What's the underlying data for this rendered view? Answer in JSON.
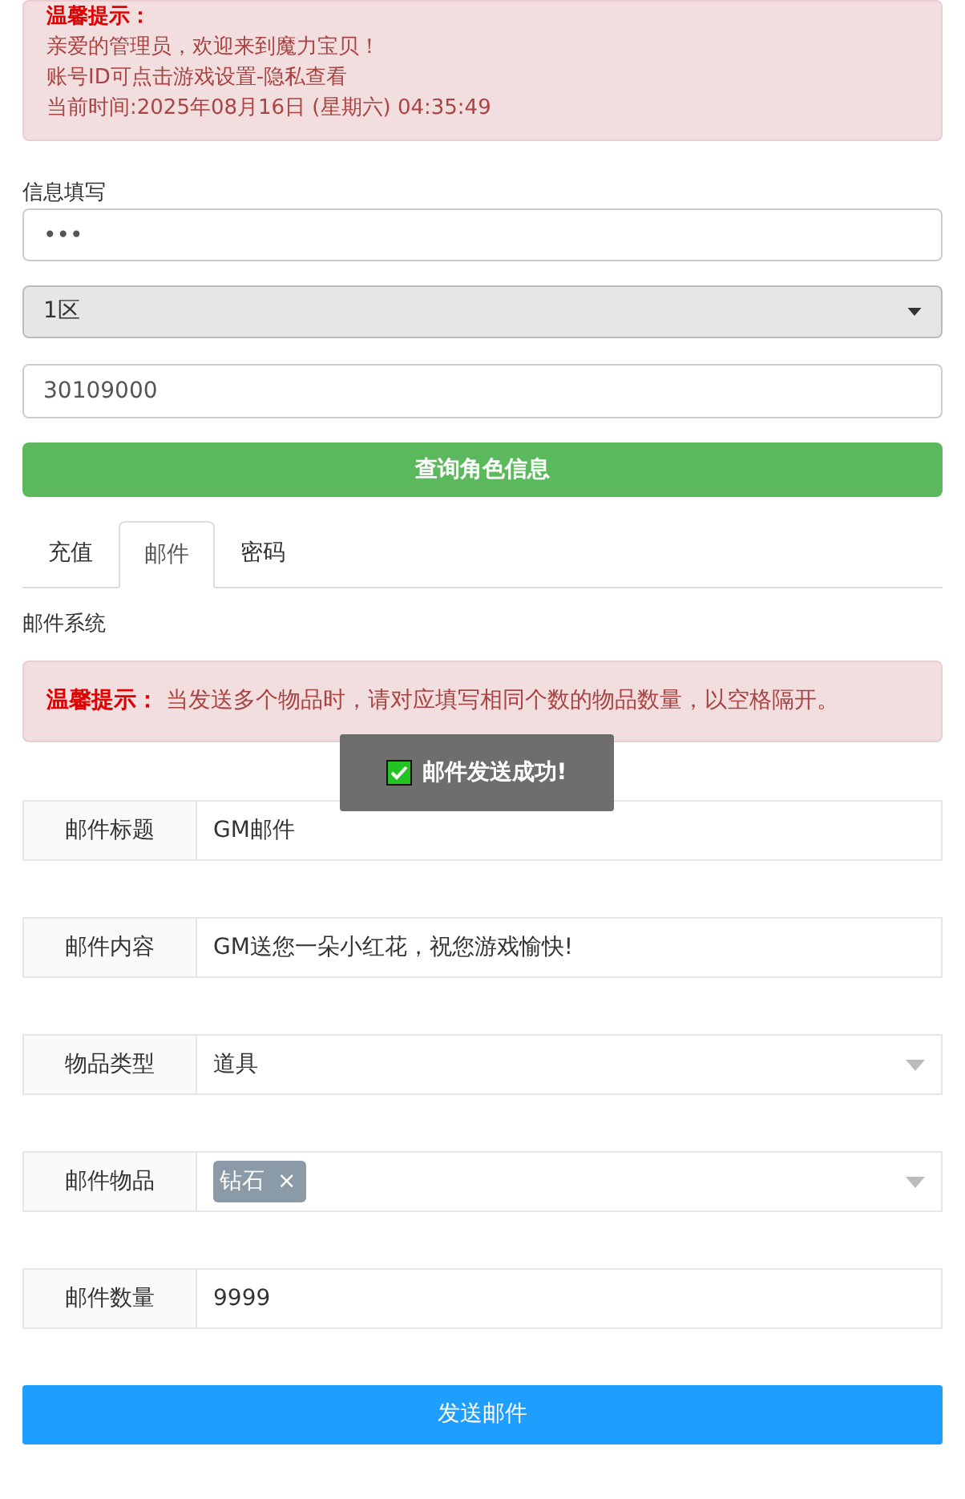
{
  "notice": {
    "title": "温馨提示：",
    "lines": [
      "亲爱的管理员，欢迎来到魔力宝贝！",
      "账号ID可点击游戏设置-隐私查看",
      "当前时间:2025年08月16日 (星期六) 04:35:49"
    ]
  },
  "info_form": {
    "label": "信息填写",
    "password_value": "•••",
    "server_select": "1区",
    "role_id_value": "30109000",
    "query_button": "查询角色信息"
  },
  "tabs": [
    {
      "label": "充值",
      "selected": false
    },
    {
      "label": "邮件",
      "selected": true
    },
    {
      "label": "密码",
      "selected": false
    }
  ],
  "mail_system": {
    "heading": "邮件系统",
    "tip_title": "温馨提示：",
    "tip_text": "当发送多个物品时，请对应填写相同个数的物品数量，以空格隔开。",
    "toast": {
      "text": "邮件发送成功!",
      "checked": true
    },
    "rows": [
      {
        "kind": "text",
        "label": "邮件标题",
        "value": "GM邮件"
      },
      {
        "kind": "text",
        "label": "邮件内容",
        "value": "GM送您一朵小红花，祝您游戏愉快!"
      },
      {
        "kind": "select",
        "label": "物品类型",
        "value": "道具"
      },
      {
        "kind": "tags",
        "label": "邮件物品",
        "tags": [
          "钻石"
        ],
        "remove": "×"
      },
      {
        "kind": "text",
        "label": "邮件数量",
        "value": "9999"
      }
    ],
    "send_button": "发送邮件"
  }
}
